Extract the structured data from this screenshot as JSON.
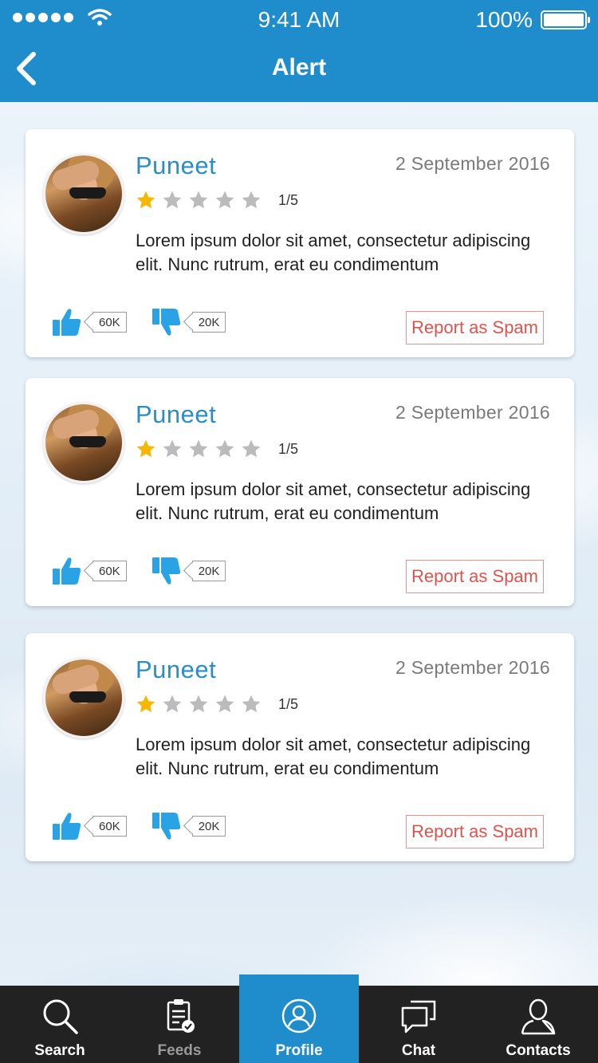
{
  "status_bar": {
    "time": "9:41 AM",
    "battery": "100%"
  },
  "header": {
    "title": "Alert",
    "back_icon": "chevron-left-icon"
  },
  "colors": {
    "primary": "#1f8ccb",
    "star_active": "#f5b800",
    "star_inactive": "#bbbbbb",
    "spam": "#e0524c",
    "thumb": "#29a3e6"
  },
  "cards": [
    {
      "name": "Puneet",
      "date": "2 September 2016",
      "rating": "1/5",
      "stars": 1,
      "text": "Lorem ipsum dolor sit amet, consectetur adipiscing elit. Nunc rutrum, erat eu condimentum",
      "likes": "60K",
      "dislikes": "20K",
      "spam_label": "Report as Spam"
    },
    {
      "name": "Puneet",
      "date": "2 September 2016",
      "rating": "1/5",
      "stars": 1,
      "text": "Lorem ipsum dolor sit amet, consectetur adipiscing elit. Nunc rutrum, erat eu condimentum",
      "likes": "60K",
      "dislikes": "20K",
      "spam_label": "Report as Spam"
    },
    {
      "name": "Puneet",
      "date": "2 September 2016",
      "rating": "1/5",
      "stars": 1,
      "text": "Lorem ipsum dolor sit amet, consectetur adipiscing elit. Nunc rutrum, erat eu condimentum",
      "likes": "60K",
      "dislikes": "20K",
      "spam_label": "Report as Spam"
    }
  ],
  "tabbar": {
    "items": [
      {
        "label": "Search",
        "icon": "search-icon"
      },
      {
        "label": "Feeds",
        "icon": "clipboard-icon"
      },
      {
        "label": "Profile",
        "icon": "profile-icon",
        "active": true
      },
      {
        "label": "Chat",
        "icon": "chat-icon"
      },
      {
        "label": "Contacts",
        "icon": "contacts-icon"
      }
    ]
  }
}
